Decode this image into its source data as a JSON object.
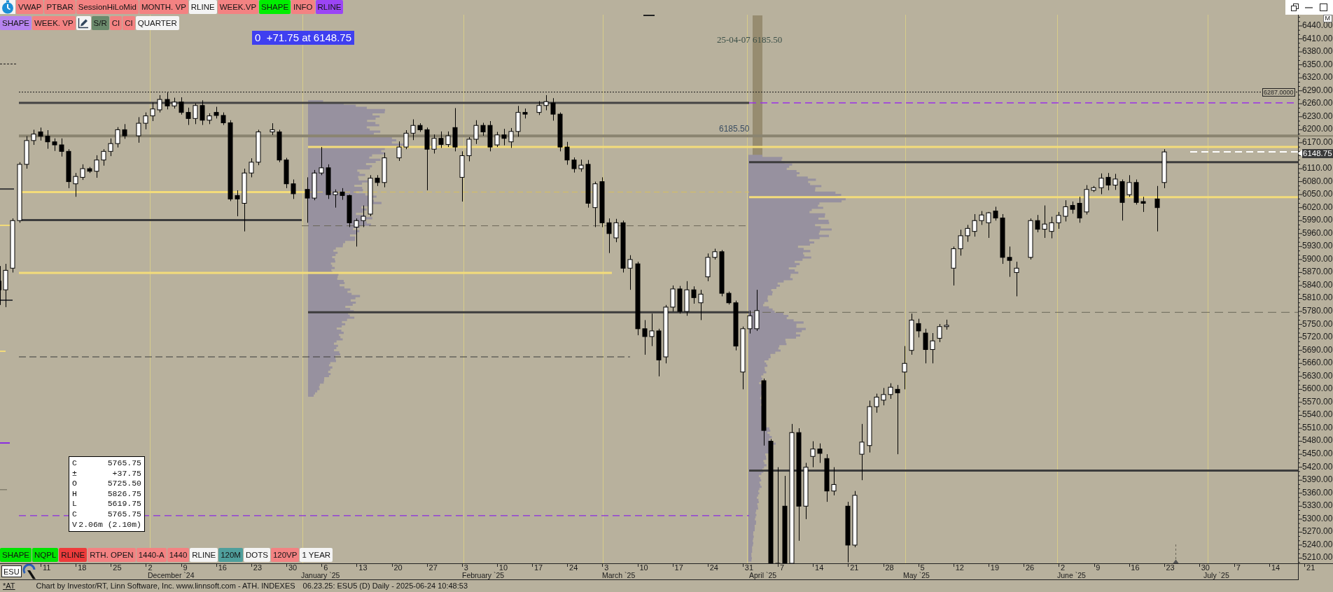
{
  "toolbar_top": [
    {
      "label": "VWAP",
      "color": "#f38282"
    },
    {
      "label": "PTBAR",
      "color": "#f38282"
    },
    {
      "label": "SessionHiLoMid",
      "color": "#f38282"
    },
    {
      "label": "MONTH. VP",
      "color": "#f38282"
    },
    {
      "label": "RLINE",
      "color": "#f4f4f4"
    },
    {
      "label": "WEEK.VP",
      "color": "#f38282"
    },
    {
      "label": "SHAPE",
      "color": "#00ee00"
    },
    {
      "label": "INFO",
      "color": "#f38282"
    },
    {
      "label": "RLINE",
      "color": "#9b45f5"
    }
  ],
  "toolbar_second": [
    {
      "kind": "text",
      "label": "SHAPE",
      "color": "#b784f0"
    },
    {
      "kind": "text",
      "label": "WEEK. VP",
      "color": "#f38282"
    },
    {
      "kind": "tool",
      "color": "#f4f4f4"
    },
    {
      "kind": "text",
      "label": "S/R",
      "color": "#6b8a6c"
    },
    {
      "kind": "text",
      "label": "CI",
      "color": "#f38282"
    },
    {
      "kind": "text",
      "label": "CI",
      "color": "#f38282"
    },
    {
      "kind": "text",
      "label": "QUARTER",
      "color": "#f4f4f4"
    }
  ],
  "chart": {
    "price_flag": "0  +71.75 at 6148.75",
    "marker_label": "25-04-07 6185.50",
    "level_label": "6185.50",
    "line_value": "6287.0000"
  },
  "price_axis": {
    "mode_button": "M",
    "labels_above": [
      "6440.00",
      "6410.00",
      "6380.00",
      "6350.00",
      "6320.00",
      "6290.00",
      "6260.00",
      "6230.00",
      "6200.00",
      "6170.00"
    ],
    "current_price": "6148.75",
    "labels_below": [
      "6110.00",
      "6080.00",
      "6050.00",
      "6020.00",
      "5990.00",
      "5960.00",
      "5930.00",
      "5900.00",
      "5870.00",
      "5840.00",
      "5810.00",
      "5780.00",
      "5750.00",
      "5720.00",
      "5690.00",
      "5660.00",
      "5630.00",
      "5600.00",
      "5570.00",
      "5540.00",
      "5510.00",
      "5480.00",
      "5450.00",
      "5420.00",
      "5390.00",
      "5360.00",
      "5330.00",
      "5300.00",
      "5270.00",
      "5240.00",
      "5210.00"
    ]
  },
  "data_window": [
    {
      "label": "C",
      "value": "5765.75"
    },
    {
      "label": "±",
      "value": "+37.75"
    },
    {
      "label": "O",
      "value": "5725.50"
    },
    {
      "label": "H",
      "value": "5826.75"
    },
    {
      "label": "L",
      "value": "5619.75"
    },
    {
      "label": "C",
      "value": "5765.75"
    },
    {
      "label": "V",
      "value": "2.06m (2.10m)"
    }
  ],
  "toolbar_bottom": [
    {
      "label": "SHAPE",
      "color": "#00e400"
    },
    {
      "label": "NQPL",
      "color": "#00e400"
    },
    {
      "label": "RLINE",
      "color": "#ee3b3b"
    },
    {
      "label": "RTH. OPEN",
      "color": "#f38282"
    },
    {
      "label": "1440-A",
      "color": "#f38282"
    },
    {
      "label": "1440",
      "color": "#f38282"
    },
    {
      "label": "RLINE",
      "color": "#f4f4f4"
    },
    {
      "label": "120M",
      "color": "#4f9f9c"
    },
    {
      "label": "DOTS",
      "color": "#f4f4f4"
    },
    {
      "label": "120VP",
      "color": "#f38282"
    },
    {
      "label": "1 YEAR",
      "color": "#f4f4f4"
    }
  ],
  "time_axis": {
    "day_labels": [
      "11",
      "18",
      "25",
      "2",
      "9",
      "16",
      "23",
      "30",
      "6",
      "13",
      "20",
      "27",
      "3",
      "10",
      "17",
      "24",
      "3",
      "10",
      "17",
      "24",
      "31",
      "7",
      "14",
      "21",
      "28",
      "5",
      "12",
      "19",
      "26",
      "2",
      "9",
      "16",
      "23",
      "30",
      "7",
      "14",
      "21"
    ],
    "month_labels": [
      "December `24",
      "January `25",
      "February `25",
      "March `25",
      "April `25",
      "May `25",
      "June `25",
      "July `25"
    ]
  },
  "symbol_field": {
    "value": "ESU"
  },
  "status_bar": {
    "marker": "*AT",
    "credit": "Chart by Investor/RT, Linn Software, Inc. www.linnsoft.com - ATH. INDEXES",
    "chart_info": "06.23.25: ESU5 (D) Daily - 2025-06-24 10:48:53"
  }
}
